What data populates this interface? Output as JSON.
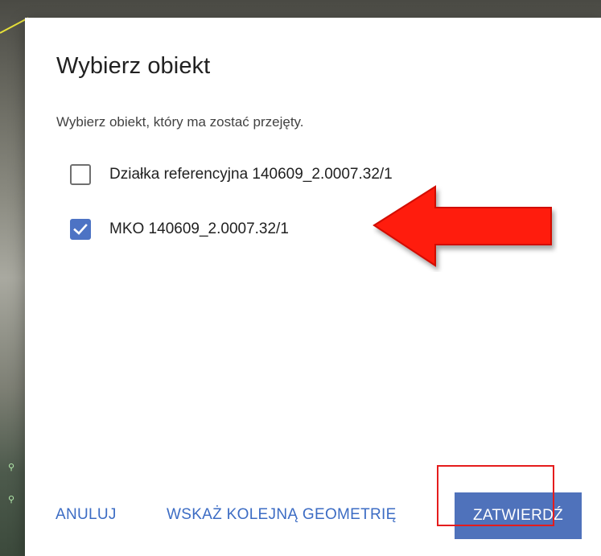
{
  "dialog": {
    "title": "Wybierz obiekt",
    "subtitle": "Wybierz obiekt, który ma zostać przejęty.",
    "options": [
      {
        "label": "Działka referencyjna 140609_2.0007.32/1",
        "checked": false
      },
      {
        "label": "MKO 140609_2.0007.32/1",
        "checked": true
      }
    ],
    "actions": {
      "cancel_label": "ANULUJ",
      "next_geometry_label": "WSKAŻ KOLEJNĄ GEOMETRIĘ",
      "confirm_label": "ZATWIERDŹ"
    }
  },
  "colors": {
    "accent": "#4f72bb",
    "checkbox_checked": "#4d73c4",
    "annotation_red": "#e51c1c"
  },
  "icons": {
    "checkmark": "check-icon",
    "annotation_arrow": "arrow-left-icon"
  }
}
